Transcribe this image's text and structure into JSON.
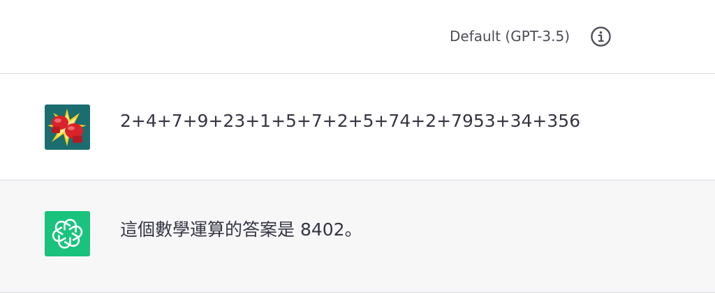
{
  "header": {
    "model_label": "Default (GPT-3.5)",
    "info_icon": "info-circle-icon"
  },
  "messages": [
    {
      "role": "user",
      "avatar_icon": "boxing-gloves-avatar-icon",
      "text": "2+4+7+9+23+1+5+7+2+5+74+2+7953+34+356"
    },
    {
      "role": "assistant",
      "avatar_icon": "openai-logo-icon",
      "text": "這個數學運算的答案是 8402。"
    }
  ],
  "colors": {
    "assistant_avatar_bg": "#19c37d",
    "user_avatar_bg": "#1c6d70",
    "assistant_row_bg": "#f7f7f8",
    "text": "#343541"
  }
}
